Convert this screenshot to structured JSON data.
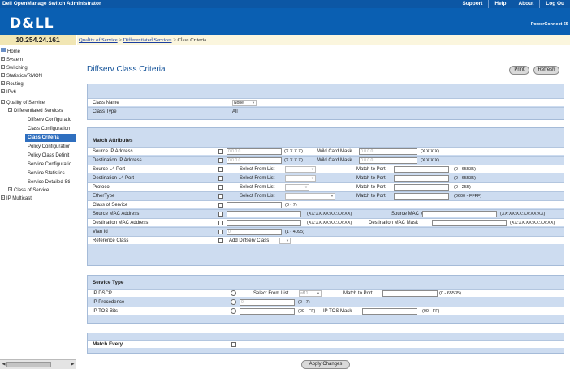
{
  "app": {
    "title": "Dell OpenManage Switch Administrator",
    "links": [
      "Support",
      "Help",
      "About",
      "Log Ou"
    ],
    "logo": "D&LL",
    "model": "PowerConnect 65"
  },
  "ip": "10.254.24.161",
  "breadcrumb": {
    "part1": "Quality of Service",
    "sep1": " > ",
    "part2": "Differentiated Services",
    "sep2": " > ",
    "current": "Class Criteria"
  },
  "nav": {
    "items": [
      {
        "label": "Home",
        "toggle": ""
      },
      {
        "label": "System",
        "toggle": "+"
      },
      {
        "label": "Switching",
        "toggle": "+"
      },
      {
        "label": "Statistics/RMON",
        "toggle": "+"
      },
      {
        "label": "Routing",
        "toggle": "+"
      },
      {
        "label": "IPv6",
        "toggle": "+"
      },
      {
        "label": "Quality of Service",
        "toggle": "-"
      },
      {
        "label": "Differentiated Services",
        "toggle": "-"
      },
      {
        "label": "Diffserv Configuratio",
        "toggle": ""
      },
      {
        "label": "Class Configuration",
        "toggle": ""
      },
      {
        "label": "Class Criteria",
        "toggle": ""
      },
      {
        "label": "Policy Configuratior",
        "toggle": ""
      },
      {
        "label": "Policy Class Definit",
        "toggle": ""
      },
      {
        "label": "Service Configuratio",
        "toggle": ""
      },
      {
        "label": "Service Statistics",
        "toggle": ""
      },
      {
        "label": "Service Detailed Sti",
        "toggle": ""
      },
      {
        "label": "Class of Service",
        "toggle": "+"
      },
      {
        "label": "IP Multicast",
        "toggle": "+"
      }
    ]
  },
  "page": {
    "title": "Diffserv Class Criteria",
    "print": "Print",
    "refresh": "Refresh",
    "apply": "Apply Changes"
  },
  "class": {
    "name_label": "Class Name",
    "name_value": "None",
    "type_label": "Class Type",
    "type_value": "All"
  },
  "match": {
    "header": "Match Attributes",
    "src_ip": "Source IP Address",
    "dst_ip": "Destination IP Address",
    "ip_placeholder": "0.0.0.0",
    "ip_hint": "(X.X.X.X)",
    "wildcard": "Wild Card Mask",
    "src_l4": "Source L4 Port",
    "dst_l4": "Destination L4 Port",
    "protocol": "Protocol",
    "ethertype": "EtherType",
    "select_from_list": "Select From List",
    "match_to_port": "Match to Port",
    "port_range": "(0 - 65535)",
    "protocol_range": "(0 - 255)",
    "ethertype_range": "(0600 - FFFF)",
    "cos": "Class of Service",
    "cos_range": "(0 - 7)",
    "src_mac": "Source MAC Address",
    "dst_mac": "Destination MAC Address",
    "mac_hint": "(XX:XX:XX:XX:XX:XX)",
    "src_mac_mask": "Source MAC Mask",
    "dst_mac_mask": "Destination MAC Mask",
    "vlan": "Vlan Id",
    "vlan_value": "0",
    "vlan_range": "(1 - 4095)",
    "ref_class": "Reference Class",
    "add_diffserv": "Add Diffserv Class"
  },
  "service": {
    "header": "Service Type",
    "dscp": "IP DSCP",
    "dscp_select": "Select From List",
    "dscp_value": "af11",
    "match_to_port": "Match to Port",
    "dscp_range": "(0 - 65535)",
    "precedence": "IP Precedence",
    "precedence_value": "0",
    "precedence_range": "(0 - 7)",
    "tos": "IP TOS Bits",
    "tos_range": "(00 - FF)",
    "tos_mask": "IP TOS Mask",
    "tos_mask_range": "(00 - FF)"
  },
  "every": {
    "label": "Match Every"
  }
}
